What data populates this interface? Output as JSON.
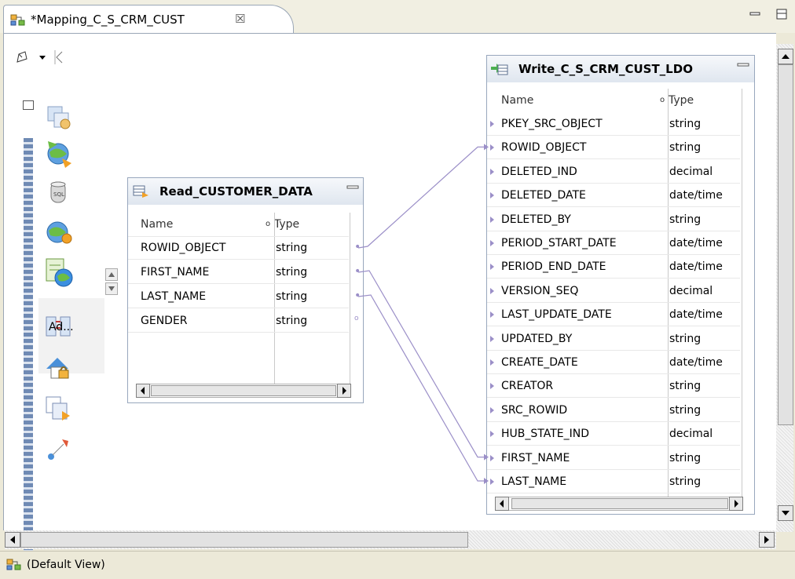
{
  "tab": {
    "title": "*Mapping_C_S_CRM_CUST",
    "close_glyph": "☒"
  },
  "palette": {
    "selected_label": "Ad...",
    "icons": [
      "aggregator-icon",
      "join-globe-icon",
      "sql-icon",
      "web-service-icon",
      "address-validator-icon",
      "matcher-icon",
      "key-lock-icon",
      "merge-icon",
      "router-icon"
    ]
  },
  "read": {
    "title": "Read_CUSTOMER_DATA",
    "header_name": "Name",
    "header_type": "Type",
    "rows": [
      {
        "name": "ROWID_OBJECT",
        "type": "string"
      },
      {
        "name": "FIRST_NAME",
        "type": "string"
      },
      {
        "name": "LAST_NAME",
        "type": "string"
      },
      {
        "name": "GENDER",
        "type": "string"
      }
    ]
  },
  "write": {
    "title": "Write_C_S_CRM_CUST_LDO",
    "header_name": "Name",
    "header_type": "Type",
    "rows": [
      {
        "name": "PKEY_SRC_OBJECT",
        "type": "string"
      },
      {
        "name": "ROWID_OBJECT",
        "type": "string"
      },
      {
        "name": "DELETED_IND",
        "type": "decimal"
      },
      {
        "name": "DELETED_DATE",
        "type": "date/time"
      },
      {
        "name": "DELETED_BY",
        "type": "string"
      },
      {
        "name": "PERIOD_START_DATE",
        "type": "date/time"
      },
      {
        "name": "PERIOD_END_DATE",
        "type": "date/time"
      },
      {
        "name": "VERSION_SEQ",
        "type": "decimal"
      },
      {
        "name": "LAST_UPDATE_DATE",
        "type": "date/time"
      },
      {
        "name": "UPDATED_BY",
        "type": "string"
      },
      {
        "name": "CREATE_DATE",
        "type": "date/time"
      },
      {
        "name": "CREATOR",
        "type": "string"
      },
      {
        "name": "SRC_ROWID",
        "type": "string"
      },
      {
        "name": "HUB_STATE_IND",
        "type": "decimal"
      },
      {
        "name": "FIRST_NAME",
        "type": "string"
      },
      {
        "name": "LAST_NAME",
        "type": "string"
      }
    ]
  },
  "links": [
    {
      "from": "ROWID_OBJECT",
      "to": "ROWID_OBJECT"
    },
    {
      "from": "FIRST_NAME",
      "to": "FIRST_NAME"
    },
    {
      "from": "LAST_NAME",
      "to": "LAST_NAME"
    }
  ],
  "status": {
    "view_label": "(Default View)"
  },
  "colors": {
    "link": "#9b8fc8",
    "panel_border": "#98a7bd",
    "title_grad": "#dfe6ef"
  }
}
